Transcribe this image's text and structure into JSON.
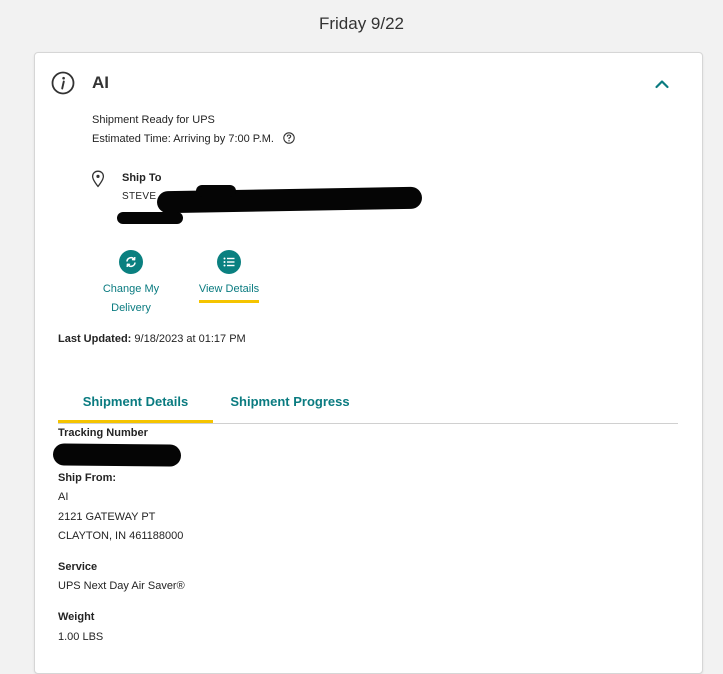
{
  "header": {
    "date": "Friday 9/22"
  },
  "shipment": {
    "shipper": "AI",
    "status": "Shipment Ready for UPS",
    "estimated_time": "Estimated Time: Arriving by 7:00 P.M.",
    "ship_to_label": "Ship To",
    "ship_to_name": "STEVE",
    "actions": {
      "change_delivery_line1": "Change My",
      "change_delivery_line2": "Delivery",
      "view_details": "View Details"
    },
    "last_updated_label": "Last Updated:",
    "last_updated_value": "9/18/2023 at 01:17 PM"
  },
  "tabs": [
    {
      "label": "Shipment Details",
      "active": true
    },
    {
      "label": "Shipment Progress",
      "active": false
    }
  ],
  "details": {
    "tracking_label": "Tracking Number",
    "ship_from_label": "Ship From:",
    "ship_from_lines": [
      "AI",
      "2121 GATEWAY PT",
      "CLAYTON, IN 461188000"
    ],
    "service_label": "Service",
    "service_value": "UPS Next Day Air Saver®",
    "weight_label": "Weight",
    "weight_value": "1.00 LBS"
  },
  "colors": {
    "accent_teal": "#0a7b80",
    "active_underline": "#f5c400",
    "background": "#f2f2f2"
  },
  "icons": [
    "info-icon",
    "chevron-up-icon",
    "help-icon",
    "location-pin-icon",
    "refresh-icon",
    "list-icon"
  ]
}
